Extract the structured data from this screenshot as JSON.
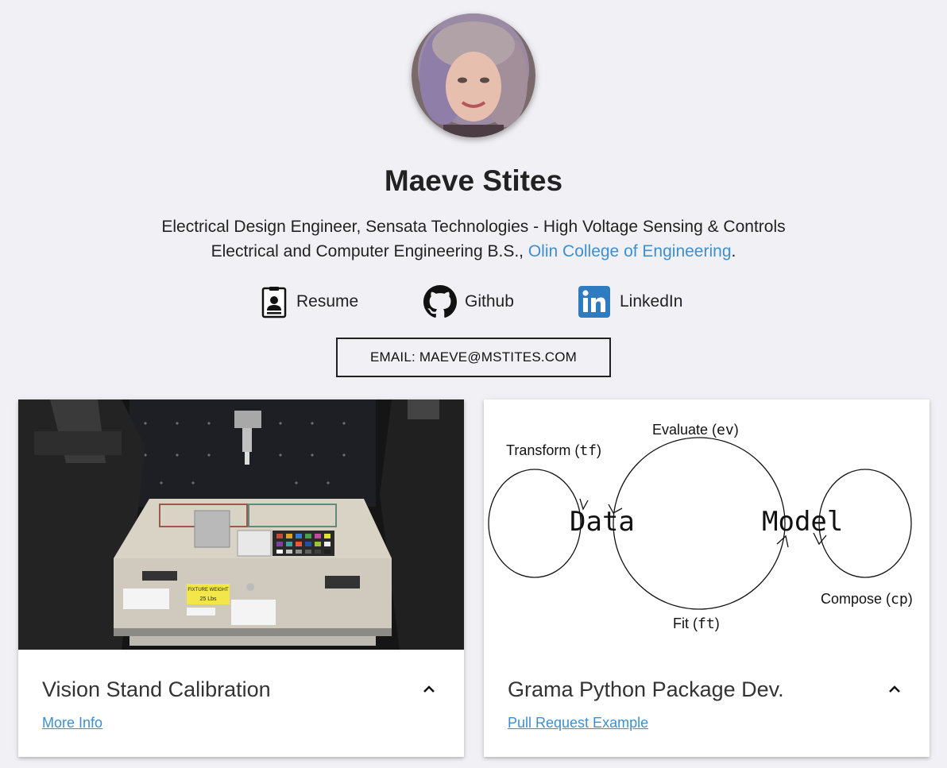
{
  "profile": {
    "name": "Maeve Stites",
    "line1": "Electrical Design Engineer, Sensata Technologies - High Voltage Sensing & Controls",
    "line2_prefix": "Electrical and Computer Engineering B.S., ",
    "line2_link": "Olin College of Engineering",
    "line2_suffix": "."
  },
  "social": {
    "resume": {
      "label": "Resume",
      "icon": "resume-badge-icon"
    },
    "github": {
      "label": "Github",
      "icon": "github-icon"
    },
    "linkedin": {
      "label": "LinkedIn",
      "icon": "linkedin-icon"
    }
  },
  "email_button": "EMAIL: MAEVE@MSTITES.COM",
  "cards": [
    {
      "title": "Vision Stand Calibration",
      "link": "More Info",
      "photo_labels": {
        "fixture": "FIXTURE WEIGHT",
        "weight": "25 Lbs"
      }
    },
    {
      "title": "Grama Python Package Dev.",
      "link": "Pull Request Example",
      "diagram": {
        "node_data": "Data",
        "node_model": "Model",
        "transform_label": "Transform (",
        "transform_code": "tf",
        "evaluate_label": "Evaluate (",
        "evaluate_code": "ev",
        "fit_label": "Fit (",
        "fit_code": "ft",
        "compose_label": "Compose (",
        "compose_code": "cp",
        "close_paren": ")"
      }
    }
  ],
  "colors": {
    "background": "#f1f1f5",
    "link": "#3d8fd0",
    "linkedin": "#2f7bbf",
    "text": "#222222"
  }
}
